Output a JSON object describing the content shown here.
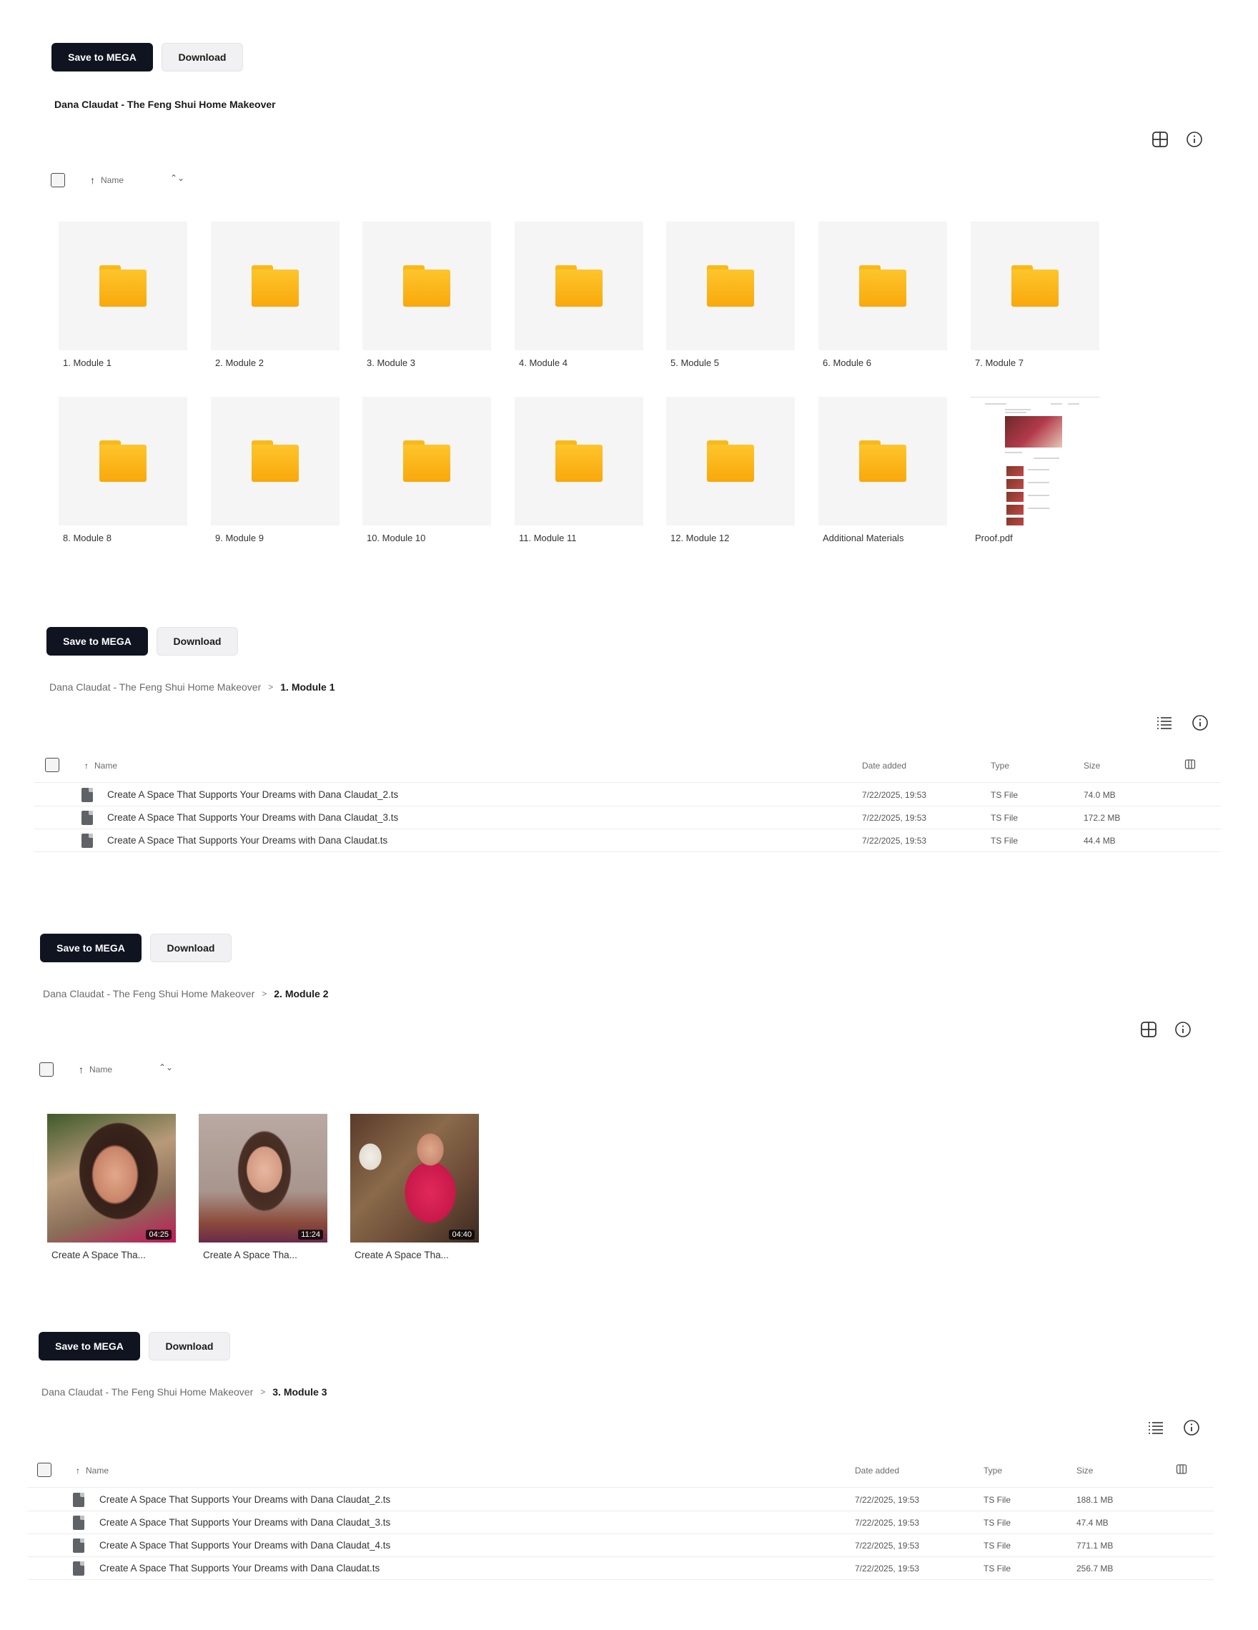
{
  "common": {
    "save_label": "Save to MEGA",
    "download_label": "Download",
    "root_folder": "Dana Claudat - The Feng Shui Home Makeover",
    "breadcrumb_separator": ">",
    "sort_label": "Name"
  },
  "section1": {
    "title": "Dana Claudat - The Feng Shui Home Makeover",
    "tiles": [
      {
        "label": "1. Module 1"
      },
      {
        "label": "2. Module 2"
      },
      {
        "label": "3. Module 3"
      },
      {
        "label": "4. Module 4"
      },
      {
        "label": "5. Module 5"
      },
      {
        "label": "6. Module 6"
      },
      {
        "label": "7. Module 7"
      },
      {
        "label": "8. Module 8"
      },
      {
        "label": "9. Module 9"
      },
      {
        "label": "10. Module 10"
      },
      {
        "label": "11. Module 11"
      },
      {
        "label": "12. Module 12"
      },
      {
        "label": "Additional Materials"
      },
      {
        "label": "Proof.pdf"
      }
    ]
  },
  "section2": {
    "current": "1. Module 1",
    "columns": {
      "name": "Name",
      "date": "Date added",
      "type": "Type",
      "size": "Size"
    },
    "rows": [
      {
        "name": "Create A Space That Supports Your Dreams with Dana Claudat_2.ts",
        "date": "7/22/2025, 19:53",
        "type": "TS File",
        "size": "74.0 MB"
      },
      {
        "name": "Create A Space That Supports Your Dreams with Dana Claudat_3.ts",
        "date": "7/22/2025, 19:53",
        "type": "TS File",
        "size": "172.2 MB"
      },
      {
        "name": "Create A Space That Supports Your Dreams with Dana Claudat.ts",
        "date": "7/22/2025, 19:53",
        "type": "TS File",
        "size": "44.4 MB"
      }
    ]
  },
  "section3": {
    "current": "2. Module 2",
    "videos": [
      {
        "label": "Create A Space Tha...",
        "duration": "04:25"
      },
      {
        "label": "Create A Space Tha...",
        "duration": "11:24"
      },
      {
        "label": "Create A Space Tha...",
        "duration": "04:40"
      }
    ]
  },
  "section4": {
    "current": "3. Module 3",
    "columns": {
      "name": "Name",
      "date": "Date added",
      "type": "Type",
      "size": "Size"
    },
    "rows": [
      {
        "name": "Create A Space That Supports Your Dreams with Dana Claudat_2.ts",
        "date": "7/22/2025, 19:53",
        "type": "TS File",
        "size": "188.1 MB"
      },
      {
        "name": "Create A Space That Supports Your Dreams with Dana Claudat_3.ts",
        "date": "7/22/2025, 19:53",
        "type": "TS File",
        "size": "47.4 MB"
      },
      {
        "name": "Create A Space That Supports Your Dreams with Dana Claudat_4.ts",
        "date": "7/22/2025, 19:53",
        "type": "TS File",
        "size": "771.1 MB"
      },
      {
        "name": "Create A Space That Supports Your Dreams with Dana Claudat.ts",
        "date": "7/22/2025, 19:53",
        "type": "TS File",
        "size": "256.7 MB"
      }
    ]
  },
  "colors": {
    "primary_button": "#0f1420",
    "folder_yellow": "#fcb81d"
  }
}
